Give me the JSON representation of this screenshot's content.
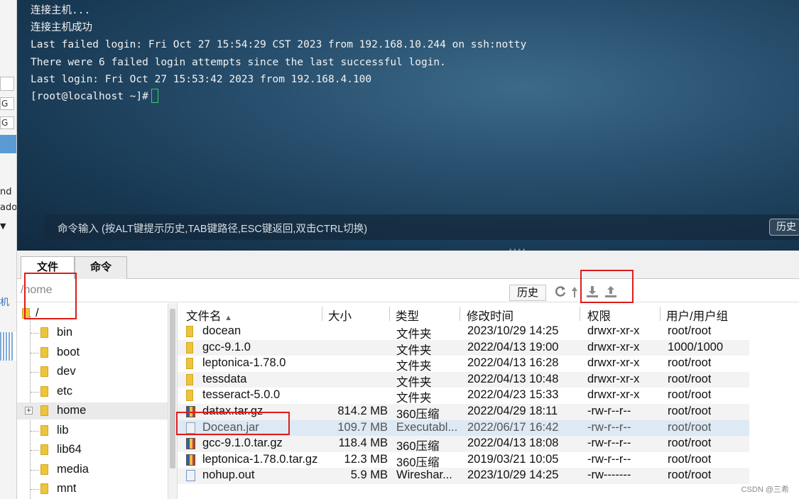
{
  "sidebar_fragments": {
    "g1": "G",
    "g2": "G",
    "nd": "nd",
    "ado": "ado",
    "ji": "机"
  },
  "terminal": {
    "lines": [
      "连接主机...",
      "连接主机成功",
      "Last failed login: Fri Oct 27 15:54:29 CST 2023 from 192.168.10.244 on ssh:notty",
      "There were 6 failed login attempts since the last successful login.",
      "Last login: Fri Oct 27 15:53:42 2023 from 192.168.4.100"
    ],
    "prompt": "[root@localhost ~]#"
  },
  "command_bar": {
    "hint": "命令输入 (按ALT键提示历史,TAB键路径,ESC键返回,双击CTRL切换)",
    "history_label": "历史"
  },
  "tabs": [
    {
      "label": "文件",
      "active": true
    },
    {
      "label": "命令",
      "active": false
    }
  ],
  "path": {
    "value": "/home",
    "history_label": "历史"
  },
  "toolbar_icons": [
    "refresh-icon",
    "up-icon",
    "download-icon",
    "upload-icon"
  ],
  "tree": {
    "root": "/",
    "items": [
      "bin",
      "boot",
      "dev",
      "etc",
      "home",
      "lib",
      "lib64",
      "media",
      "mnt"
    ],
    "selected": "home"
  },
  "file_list": {
    "columns": [
      "文件名",
      "大小",
      "类型",
      "修改时间",
      "权限",
      "用户/用户组"
    ],
    "sort_indicator": "▲",
    "rows": [
      {
        "name": "docean",
        "size": "",
        "type": "文件夹",
        "mtime": "2023/10/29 14:25",
        "perm": "drwxr-xr-x",
        "owner": "root/root",
        "icon": "folder"
      },
      {
        "name": "gcc-9.1.0",
        "size": "",
        "type": "文件夹",
        "mtime": "2022/04/13 19:00",
        "perm": "drwxr-xr-x",
        "owner": "1000/1000",
        "icon": "folder"
      },
      {
        "name": "leptonica-1.78.0",
        "size": "",
        "type": "文件夹",
        "mtime": "2022/04/13 16:28",
        "perm": "drwxr-xr-x",
        "owner": "root/root",
        "icon": "folder"
      },
      {
        "name": "tessdata",
        "size": "",
        "type": "文件夹",
        "mtime": "2022/04/13 10:48",
        "perm": "drwxr-xr-x",
        "owner": "root/root",
        "icon": "folder"
      },
      {
        "name": "tesseract-5.0.0",
        "size": "",
        "type": "文件夹",
        "mtime": "2022/04/23 15:33",
        "perm": "drwxr-xr-x",
        "owner": "root/root",
        "icon": "folder"
      },
      {
        "name": "datax.tar.gz",
        "size": "814.2 MB",
        "type": "360压缩",
        "mtime": "2022/04/29 18:11",
        "perm": "-rw-r--r--",
        "owner": "root/root",
        "icon": "archive"
      },
      {
        "name": "Docean.jar",
        "size": "109.7 MB",
        "type": "Executabl...",
        "mtime": "2022/06/17 16:42",
        "perm": "-rw-r--r--",
        "owner": "root/root",
        "icon": "jar"
      },
      {
        "name": "gcc-9.1.0.tar.gz",
        "size": "118.4 MB",
        "type": "360压缩",
        "mtime": "2022/04/13 18:08",
        "perm": "-rw-r--r--",
        "owner": "root/root",
        "icon": "archive"
      },
      {
        "name": "leptonica-1.78.0.tar.gz",
        "size": "12.3 MB",
        "type": "360压缩",
        "mtime": "2019/03/21 10:05",
        "perm": "-rw-r--r--",
        "owner": "root/root",
        "icon": "archive"
      },
      {
        "name": "nohup.out",
        "size": "5.9 MB",
        "type": "Wireshar...",
        "mtime": "2023/10/29 14:25",
        "perm": "-rw-------",
        "owner": "root/root",
        "icon": "out"
      }
    ],
    "selected_row": "Docean.jar"
  },
  "watermark": "CSDN @三希",
  "colors": {
    "annotation_red": "#e01b1b",
    "selection": "#dde9f4",
    "cursor": "#2fd26a"
  }
}
